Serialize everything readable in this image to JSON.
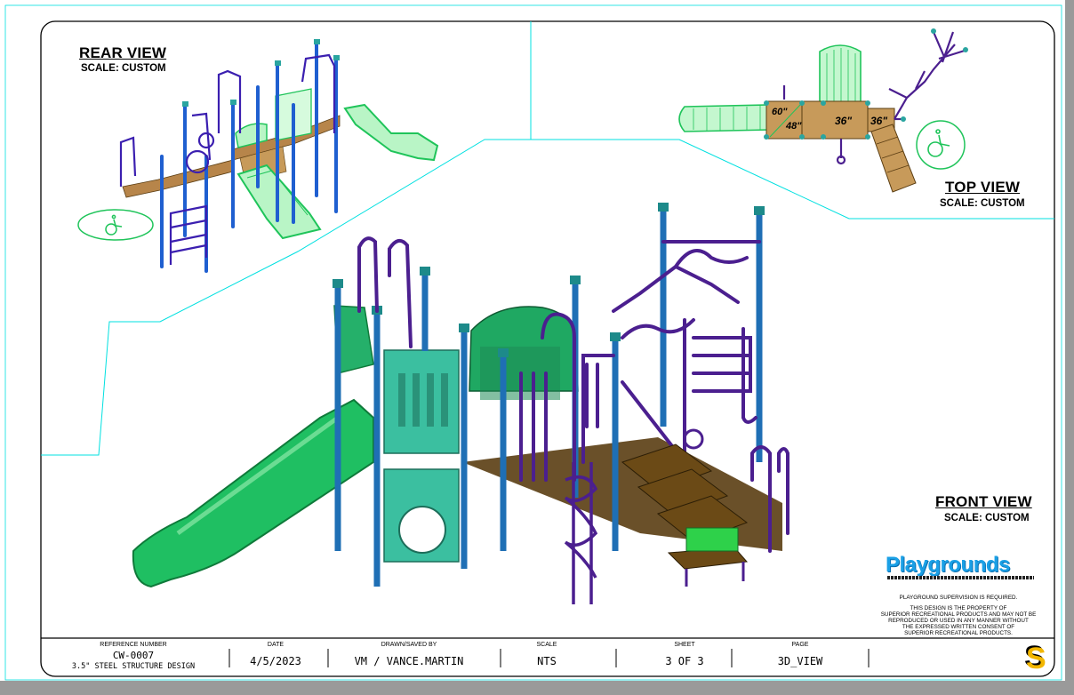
{
  "views": {
    "rear": {
      "title": "REAR VIEW",
      "scale": "SCALE: CUSTOM"
    },
    "top": {
      "title": "TOP VIEW",
      "scale": "SCALE: CUSTOM"
    },
    "front": {
      "title": "FRONT VIEW",
      "scale": "SCALE: CUSTOM"
    }
  },
  "dimensions": [
    "60\"",
    "48\"",
    "36\"",
    "36\""
  ],
  "brand": {
    "name": "Playgrounds",
    "notice_supervision": "PLAYGROUND SUPERVISION IS REQUIRED.",
    "notice_property": [
      "THIS DESIGN IS THE PROPERTY OF",
      "SUPERIOR RECREATIONAL PRODUCTS AND MAY NOT BE",
      "REPRODUCED OR USED IN ANY MANNER WITHOUT",
      "THE EXPRESSED WRITTEN CONSENT OF",
      "SUPERIOR RECREATIONAL PRODUCTS."
    ]
  },
  "title_block": {
    "reference_number": {
      "label": "REFERENCE NUMBER",
      "value": "CW-0007",
      "subvalue": "3.5\" STEEL STRUCTURE DESIGN"
    },
    "date": {
      "label": "DATE",
      "value": "4/5/2023"
    },
    "drawn_by": {
      "label": "DRAWN/SAVED BY",
      "value": "VM / VANCE.MARTIN"
    },
    "scale": {
      "label": "SCALE",
      "value": "NTS"
    },
    "sheet": {
      "label": "SHEET",
      "value": "3 OF 3"
    },
    "page": {
      "label": "PAGE",
      "value": "3D_VIEW"
    }
  },
  "colors": {
    "border": "#000000",
    "guide_lines": "#00e0e0",
    "slide_green": "#1fc45a",
    "panel_teal": "#3bbfa0",
    "post_blue": "#1f6fb5",
    "rail_purple": "#4b1f8f",
    "deck_brown": "#5a3d12",
    "brand_blue": "#1aa0e6"
  },
  "icons": [
    "accessible-wheelchair-icon",
    "superior-s-logo-icon"
  ]
}
